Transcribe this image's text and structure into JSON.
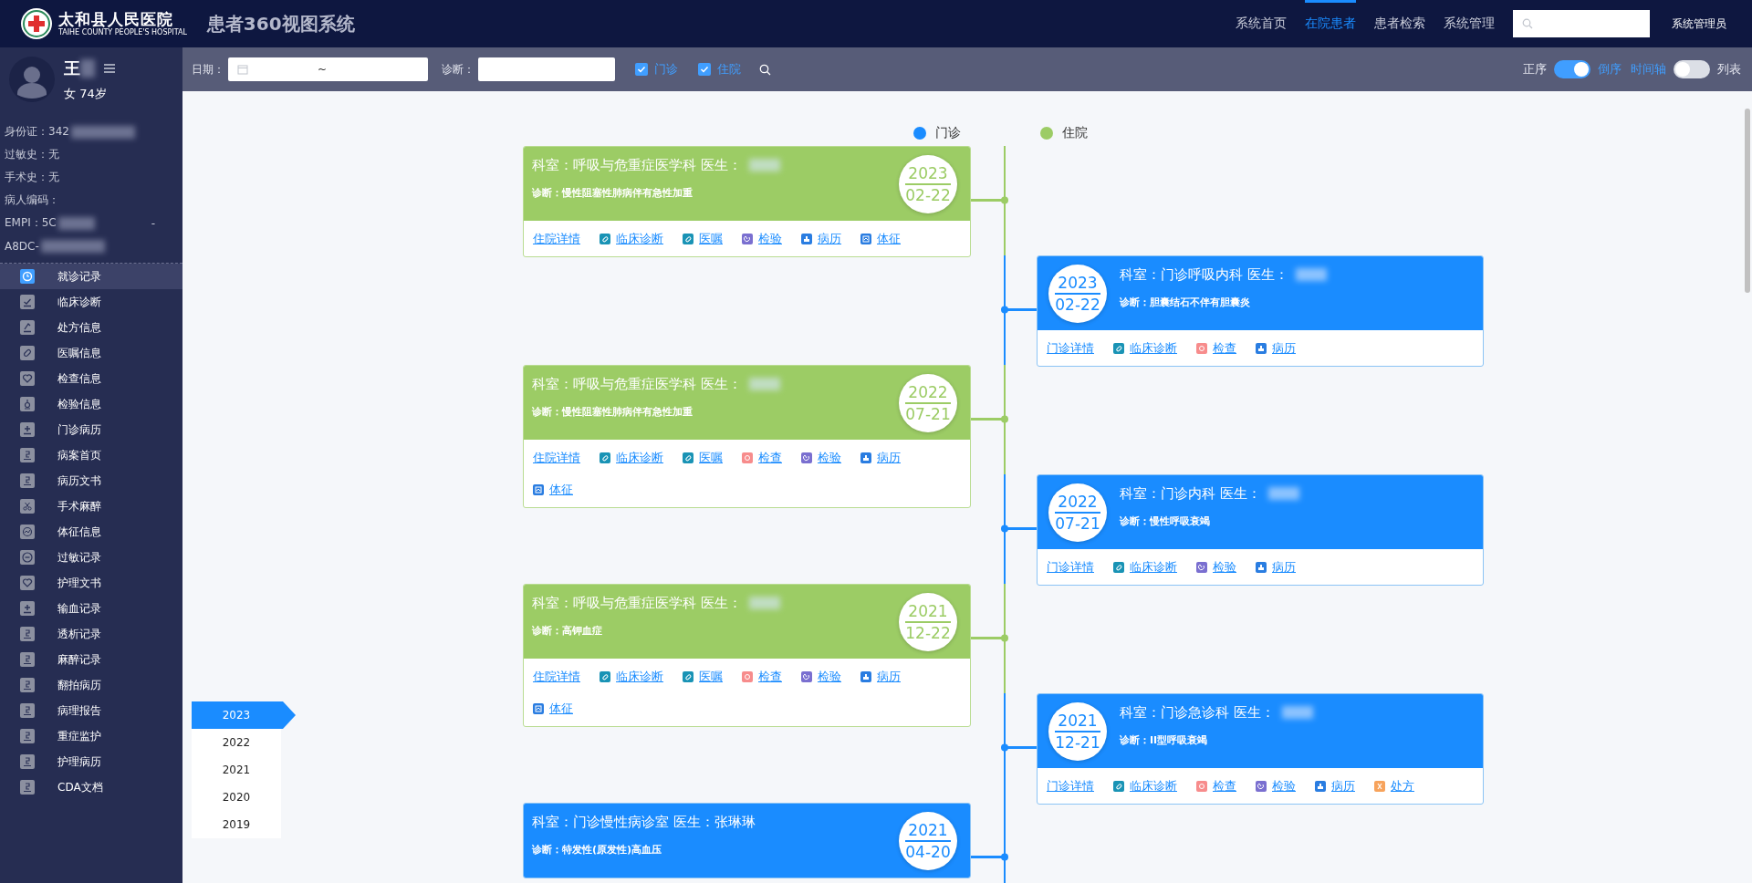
{
  "header": {
    "logo_name": "太和县人民医院",
    "logo_subtitle": "TAIHE COUNTY PEOPLE'S HOSPITAL",
    "title": "患者360视图系统",
    "nav": [
      {
        "label": "系统首页",
        "selected": false
      },
      {
        "label": "在院患者",
        "selected": true
      },
      {
        "label": "患者检索",
        "selected": false
      },
      {
        "label": "系统管理",
        "selected": false
      }
    ],
    "user": "系统管理员"
  },
  "patient": {
    "name": "王",
    "sex_age": "女 74岁",
    "info": [
      {
        "text": "身份证：342",
        "blurred": true
      },
      {
        "text": "过敏史：无",
        "blurred": false
      },
      {
        "text": "手术史：无",
        "blurred": false
      },
      {
        "text": "病人编码：",
        "blurred": false
      },
      {
        "text": "EMPI：5C",
        "blurred": true,
        "tail": "-"
      },
      {
        "text": "A8DC-",
        "blurred": true
      }
    ]
  },
  "sidebar_menu": [
    {
      "label": "就诊记录",
      "kind": "clock",
      "selected": true
    },
    {
      "label": "临床诊断",
      "kind": "check",
      "selected": false
    },
    {
      "label": "处方信息",
      "kind": "prescription",
      "selected": false
    },
    {
      "label": "医嘱信息",
      "kind": "pill",
      "selected": false
    },
    {
      "label": "检查信息",
      "kind": "heart",
      "selected": false
    },
    {
      "label": "检验信息",
      "kind": "flask",
      "selected": false
    },
    {
      "label": "门诊病历",
      "kind": "plus",
      "selected": false
    },
    {
      "label": "病案首页",
      "kind": "doc",
      "selected": false
    },
    {
      "label": "病历文书",
      "kind": "doc",
      "selected": false
    },
    {
      "label": "手术麻醉",
      "kind": "scissors",
      "selected": false
    },
    {
      "label": "体征信息",
      "kind": "vitals",
      "selected": false
    },
    {
      "label": "过敏记录",
      "kind": "minus",
      "selected": false
    },
    {
      "label": "护理文书",
      "kind": "heart",
      "selected": false
    },
    {
      "label": "输血记录",
      "kind": "plus",
      "selected": false
    },
    {
      "label": "透析记录",
      "kind": "doc",
      "selected": false
    },
    {
      "label": "麻醉记录",
      "kind": "doc",
      "selected": false
    },
    {
      "label": "翻拍病历",
      "kind": "doc",
      "selected": false
    },
    {
      "label": "病理报告",
      "kind": "doc",
      "selected": false
    },
    {
      "label": "重症监护",
      "kind": "doc",
      "selected": false
    },
    {
      "label": "护理病历",
      "kind": "doc",
      "selected": false
    },
    {
      "label": "CDA文档",
      "kind": "doc",
      "selected": false
    }
  ],
  "filter_bar": {
    "date_label": "日期：",
    "date_separator": "~",
    "diagnosis_label": "诊断：",
    "checkboxes": [
      {
        "label": "门诊",
        "checked": true
      },
      {
        "label": "住院",
        "checked": true
      }
    ],
    "toggles": [
      {
        "off_label": "正序",
        "on_label": "倒序",
        "on": true
      },
      {
        "off_label": "时间轴",
        "on_label": "列表",
        "on": false
      }
    ]
  },
  "legend": [
    {
      "label": "门诊",
      "color": "#1a8cff"
    },
    {
      "label": "住院",
      "color": "#9ccc65"
    }
  ],
  "timeline": [
    {
      "kind": "inpatient",
      "department_line": "科室：呼吸与危重症医学科 医生：",
      "doctor_hidden": true,
      "diagnosis": "诊断：慢性阻塞性肺病伴有急性加重",
      "year": "2023",
      "date": "02-22",
      "links": [
        {
          "label": "住院详情",
          "kind": "detail"
        },
        {
          "label": "临床诊断",
          "kind": "diagnosis"
        },
        {
          "label": "医嘱",
          "kind": "order"
        },
        {
          "label": "检验",
          "kind": "lab"
        },
        {
          "label": "病历",
          "kind": "record"
        },
        {
          "label": "体征",
          "kind": "vitals"
        }
      ]
    },
    {
      "kind": "outpatient",
      "department_line": "科室：门诊呼吸内科 医生：",
      "doctor_hidden": true,
      "diagnosis": "诊断：胆囊结石不伴有胆囊炎",
      "year": "2023",
      "date": "02-22",
      "links": [
        {
          "label": "门诊详情",
          "kind": "detail"
        },
        {
          "label": "临床诊断",
          "kind": "diagnosis"
        },
        {
          "label": "检查",
          "kind": "exam"
        },
        {
          "label": "病历",
          "kind": "record"
        }
      ]
    },
    {
      "kind": "inpatient",
      "department_line": "科室：呼吸与危重症医学科 医生：",
      "doctor_hidden": true,
      "diagnosis": "诊断：慢性阻塞性肺病伴有急性加重",
      "year": "2022",
      "date": "07-21",
      "links": [
        {
          "label": "住院详情",
          "kind": "detail"
        },
        {
          "label": "临床诊断",
          "kind": "diagnosis"
        },
        {
          "label": "医嘱",
          "kind": "order"
        },
        {
          "label": "检查",
          "kind": "exam"
        },
        {
          "label": "检验",
          "kind": "lab"
        },
        {
          "label": "病历",
          "kind": "record"
        },
        {
          "label": "体征",
          "kind": "vitals"
        }
      ]
    },
    {
      "kind": "outpatient",
      "department_line": "科室：门诊内科 医生：",
      "doctor_hidden": true,
      "diagnosis": "诊断：慢性呼吸衰竭",
      "year": "2022",
      "date": "07-21",
      "links": [
        {
          "label": "门诊详情",
          "kind": "detail"
        },
        {
          "label": "临床诊断",
          "kind": "diagnosis"
        },
        {
          "label": "检验",
          "kind": "lab"
        },
        {
          "label": "病历",
          "kind": "record"
        }
      ]
    },
    {
      "kind": "inpatient",
      "department_line": "科室：呼吸与危重症医学科 医生：",
      "doctor_hidden": true,
      "diagnosis": "诊断：高钾血症",
      "year": "2021",
      "date": "12-22",
      "links": [
        {
          "label": "住院详情",
          "kind": "detail"
        },
        {
          "label": "临床诊断",
          "kind": "diagnosis"
        },
        {
          "label": "医嘱",
          "kind": "order"
        },
        {
          "label": "检查",
          "kind": "exam"
        },
        {
          "label": "检验",
          "kind": "lab"
        },
        {
          "label": "病历",
          "kind": "record"
        },
        {
          "label": "体征",
          "kind": "vitals"
        }
      ]
    },
    {
      "kind": "outpatient",
      "department_line": "科室：门诊急诊科 医生：",
      "doctor_hidden": true,
      "diagnosis": "诊断：II型呼吸衰竭",
      "year": "2021",
      "date": "12-21",
      "links": [
        {
          "label": "门诊详情",
          "kind": "detail"
        },
        {
          "label": "临床诊断",
          "kind": "diagnosis"
        },
        {
          "label": "检查",
          "kind": "exam"
        },
        {
          "label": "检验",
          "kind": "lab"
        },
        {
          "label": "病历",
          "kind": "record"
        },
        {
          "label": "处方",
          "kind": "prescription"
        }
      ]
    },
    {
      "kind": "outpatient",
      "department_line": "科室：门诊慢性病诊室 医生：张琳琳",
      "doctor_hidden": false,
      "diagnosis": "诊断：特发性(原发性)高血压",
      "year": "2021",
      "date": "04-20"
    }
  ],
  "year_nav": [
    {
      "label": "2023",
      "selected": true
    },
    {
      "label": "2022",
      "selected": false
    },
    {
      "label": "2021",
      "selected": false
    },
    {
      "label": "2020",
      "selected": false
    },
    {
      "label": "2019",
      "selected": false
    }
  ]
}
